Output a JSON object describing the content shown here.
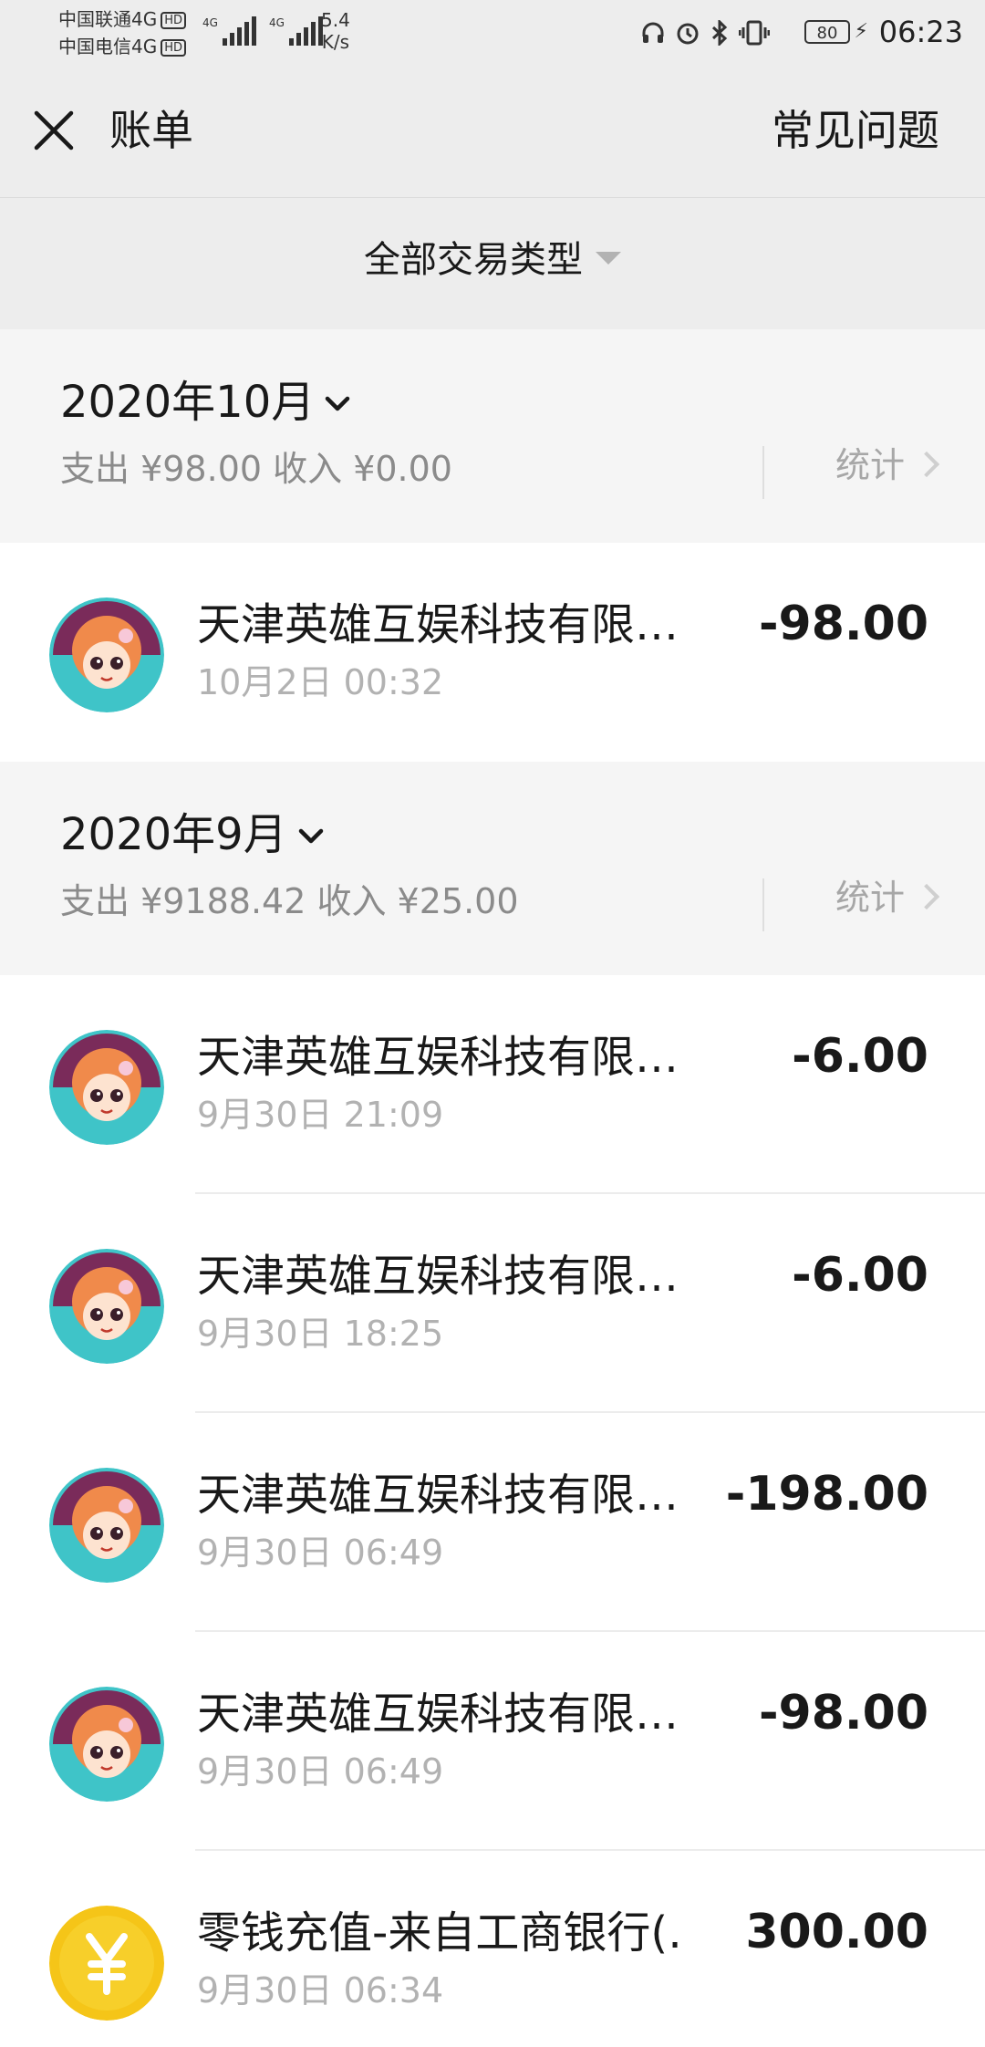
{
  "status_bar": {
    "carrier1": "中国联通4G",
    "carrier2": "中国电信4G",
    "hd": "HD",
    "net": "4G",
    "speed_value": "5.4",
    "speed_unit": "K/s",
    "battery": "80",
    "time": "06:23"
  },
  "header": {
    "title": "账单",
    "faq": "常见问题"
  },
  "filter": {
    "label": "全部交易类型"
  },
  "months": [
    {
      "title": "2020年10月",
      "summary": "支出 ¥98.00 收入 ¥0.00",
      "stats": "统计"
    },
    {
      "title": "2020年9月",
      "summary": "支出 ¥9188.42 收入 ¥25.00",
      "stats": "统计"
    }
  ],
  "transactions": [
    {
      "merchant": "天津英雄互娱科技有限…",
      "time": "10月2日 00:32",
      "amount": "-98.00",
      "icon": "game-avatar-icon"
    },
    {
      "merchant": "天津英雄互娱科技有限…",
      "time": "9月30日 21:09",
      "amount": "-6.00",
      "icon": "game-avatar-icon"
    },
    {
      "merchant": "天津英雄互娱科技有限…",
      "time": "9月30日 18:25",
      "amount": "-6.00",
      "icon": "game-avatar-icon"
    },
    {
      "merchant": "天津英雄互娱科技有限…",
      "time": "9月30日 06:49",
      "amount": "-198.00",
      "icon": "game-avatar-icon"
    },
    {
      "merchant": "天津英雄互娱科技有限…",
      "time": "9月30日 06:49",
      "amount": "-98.00",
      "icon": "game-avatar-icon"
    },
    {
      "merchant": "零钱充值-来自工商银行(…",
      "time": "9月30日 06:34",
      "amount": "300.00",
      "icon": "yuan-coin-icon"
    }
  ],
  "colors": {
    "background": "#ededed",
    "month_bg": "#f5f5f5",
    "card_bg": "#ffffff",
    "muted_text": "#b2b2b2",
    "coin": "#f5c518"
  }
}
